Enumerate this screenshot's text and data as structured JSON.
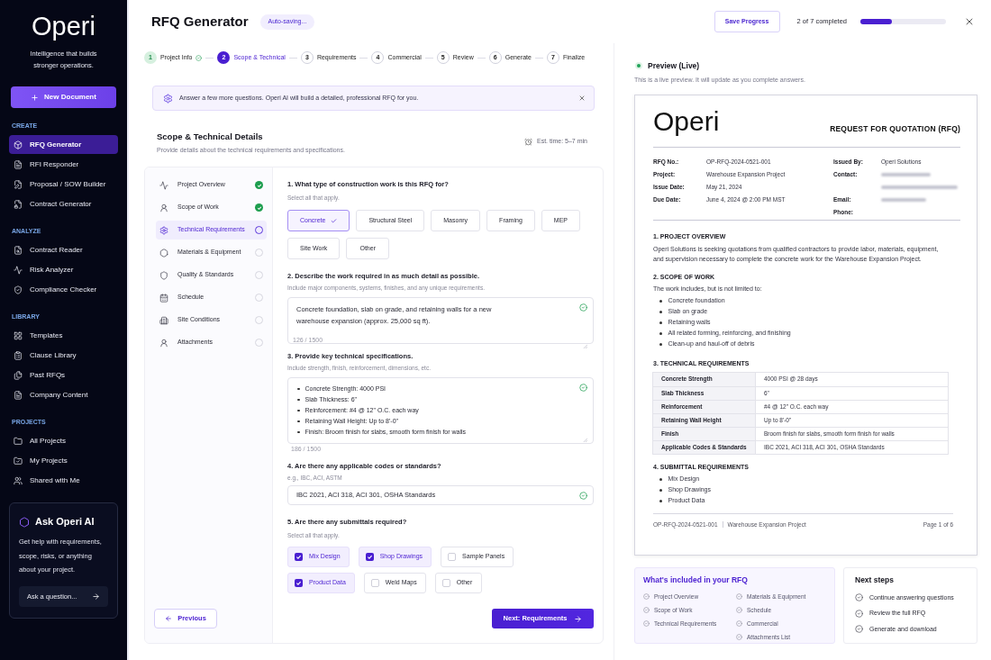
{
  "sidebar": {
    "logo": "Operi",
    "tagline": "Intelligence that builds stronger operations.",
    "new_button": "New Document",
    "sections": [
      {
        "title": "CREATE",
        "items": [
          {
            "label": "RFQ Generator",
            "selected": true
          },
          {
            "label": "RFI Responder",
            "selected": false
          },
          {
            "label": "Proposal / SOW Builder",
            "selected": false
          },
          {
            "label": "Contract Generator",
            "selected": false
          }
        ]
      },
      {
        "title": "ANALYZE",
        "items": [
          {
            "label": "Contract Reader",
            "selected": false
          },
          {
            "label": "Risk Analyzer",
            "selected": false
          },
          {
            "label": "Compliance Checker",
            "selected": false
          }
        ]
      },
      {
        "title": "LIBRARY",
        "items": [
          {
            "label": "Templates",
            "selected": false
          },
          {
            "label": "Clause Library",
            "selected": false
          },
          {
            "label": "Past RFQs",
            "selected": false
          },
          {
            "label": "Company Content",
            "selected": false
          }
        ]
      },
      {
        "title": "PROJECTS",
        "items": [
          {
            "label": "All Projects",
            "selected": false
          },
          {
            "label": "My Projects",
            "selected": false
          },
          {
            "label": "Shared with Me",
            "selected": false
          }
        ]
      }
    ],
    "assistant": {
      "title": "Ask Operi AI",
      "text": "Get help with requirements, scope, risks, or anything about your project.",
      "placeholder": "Ask a question..."
    }
  },
  "header": {
    "title": "RFQ Generator",
    "status": "Auto-saving...",
    "save_button": "Save Progress",
    "progress_text": "2 of 7 completed",
    "progress": {
      "level": 0.37
    }
  },
  "stepper": [
    {
      "number": "1",
      "label": "Project Info",
      "completed": true,
      "selected": false
    },
    {
      "number": "2",
      "label": "Scope & Technical",
      "completed": false,
      "selected": true
    },
    {
      "number": "3",
      "label": "Requirements",
      "completed": false,
      "selected": false
    },
    {
      "number": "4",
      "label": "Commercial",
      "completed": false,
      "selected": false
    },
    {
      "number": "5",
      "label": "Review",
      "completed": false,
      "selected": false
    },
    {
      "number": "6",
      "label": "Generate",
      "completed": false,
      "selected": false
    },
    {
      "number": "7",
      "label": "Finalize",
      "completed": false,
      "selected": false
    }
  ],
  "banner": {
    "text": "Answer a few more questions. Operi AI will build a detailed, professional RFQ for you."
  },
  "section": {
    "title": "Scope & Technical Details",
    "subtitle": "Provide details about the technical requirements and specifications.",
    "est_time": "Est. time: 5–7 min"
  },
  "form_nav": [
    {
      "label": "Project Overview",
      "completed": true,
      "selected": false
    },
    {
      "label": "Scope of Work",
      "completed": true,
      "selected": false
    },
    {
      "label": "Technical Requirements",
      "completed": false,
      "selected": true
    },
    {
      "label": "Materials & Equipment",
      "completed": false,
      "selected": false
    },
    {
      "label": "Quality & Standards",
      "completed": false,
      "selected": false
    },
    {
      "label": "Schedule",
      "completed": false,
      "selected": false
    },
    {
      "label": "Site Conditions",
      "completed": false,
      "selected": false
    },
    {
      "label": "Attachments",
      "completed": false,
      "selected": false
    }
  ],
  "questions": [
    {
      "kind": "chips",
      "label": "1. What type of construction work is this RFQ for?",
      "hint": "Select all that apply.",
      "options": [
        {
          "label": "Concrete",
          "selected": true
        },
        {
          "label": "Structural Steel",
          "selected": false
        },
        {
          "label": "Masonry",
          "selected": false
        },
        {
          "label": "Framing",
          "selected": false
        },
        {
          "label": "MEP",
          "selected": false
        },
        {
          "label": "Site Work",
          "selected": false
        },
        {
          "label": "Other",
          "selected": false
        }
      ]
    },
    {
      "kind": "textarea",
      "label": "2. Describe the work required in as much detail as possible.",
      "hint": "Include major components, systems, finishes, and any unique requirements.",
      "value": "Concrete foundation, slab on grade, and retaining walls for a new warehouse expansion (approx. 25,000 sq ft).",
      "counter": "126 / 1500",
      "valid": true
    },
    {
      "kind": "textarea",
      "label": "3. Provide key technical specifications.",
      "hint": "Include strength, finish, reinforcement, dimensions, etc.",
      "lines": [
        "Concrete Strength: 4000 PSI",
        "Slab Thickness: 6\"",
        "Reinforcement: #4 @ 12\" O.C. each way",
        "Retaining Wall Height: Up to 8'-0\"",
        "Finish: Broom finish for slabs, smooth form finish for walls"
      ],
      "counter": "186 / 1500",
      "valid": true
    },
    {
      "kind": "input",
      "label": "4. Are there any applicable codes or standards?",
      "hint": "e.g., IBC, ACI, ASTM",
      "value": "IBC 2021, ACI 318, ACI 301, OSHA Standards",
      "valid": true
    },
    {
      "kind": "checkboxes",
      "label": "5. Are there any submittals required?",
      "hint": "Select all that apply.",
      "options": [
        {
          "label": "Mix Design",
          "checked": true
        },
        {
          "label": "Shop Drawings",
          "checked": true
        },
        {
          "label": "Sample Panels",
          "checked": false
        },
        {
          "label": "Product Data",
          "checked": true
        },
        {
          "label": "Weld Maps",
          "checked": false
        },
        {
          "label": "Other",
          "checked": false
        }
      ]
    }
  ],
  "navigation": {
    "previous": "Previous",
    "next": "Next: Requirements"
  },
  "preview": {
    "title": "Preview (Live)",
    "subtitle": "This is a live preview. It will update as you complete answers.",
    "document": {
      "logo": "Operi",
      "heading": "REQUEST FOR QUOTATION (RFQ)",
      "meta_left": [
        {
          "label": "RFQ No.:",
          "value": "OP-RFQ-2024-0521-001"
        },
        {
          "label": "Project:",
          "value": "Warehouse Expansion Project"
        },
        {
          "label": "Issue Date:",
          "value": "May 21, 2024"
        },
        {
          "label": "Due Date:",
          "value": "June 4, 2024 @ 2:00 PM MST"
        }
      ],
      "meta_right": [
        {
          "label": "Issued By:",
          "value": "Operi Solutions",
          "blurred": false
        },
        {
          "label": "Contact:",
          "blurred": true
        },
        {
          "blurred": true
        },
        {
          "label": "Email:",
          "blurred": true
        },
        {
          "label": "Phone:",
          "blurred": false
        }
      ],
      "sections": [
        {
          "kind": "paragraph",
          "title": "1. PROJECT OVERVIEW",
          "text": "Operi Solutions is seeking quotations from qualified contractors to provide labor, materials, equipment, and supervision necessary to complete the concrete work for the Warehouse Expansion Project."
        },
        {
          "kind": "list",
          "title": "2. SCOPE OF WORK",
          "intro": "The work includes, but is not limited to:",
          "items": [
            "Concrete foundation",
            "Slab on grade",
            "Retaining walls",
            "All related forming, reinforcing, and finishing",
            "Clean-up and haul-off of debris"
          ]
        },
        {
          "kind": "table",
          "title": "3. TECHNICAL REQUIREMENTS",
          "rows": [
            [
              "Concrete Strength",
              "4000 PSI @ 28 days"
            ],
            [
              "Slab Thickness",
              "6\""
            ],
            [
              "Reinforcement",
              "#4 @ 12\" O.C. each way"
            ],
            [
              "Retaining Wall Height",
              "Up to 8'-0\""
            ],
            [
              "Finish",
              "Broom finish for slabs, smooth form finish for walls"
            ],
            [
              "Applicable Codes & Standards",
              "IBC 2021, ACI 318, ACI 301, OSHA Standards"
            ]
          ]
        },
        {
          "kind": "list",
          "title": "4. SUBMITTAL REQUIREMENTS",
          "items": [
            "Mix Design",
            "Shop Drawings",
            "Product Data"
          ]
        }
      ],
      "footer": {
        "rfq_number": "OP-RFQ-2024-0521-001",
        "project": "Warehouse Expansion Project",
        "page": "Page 1 of 6"
      }
    }
  },
  "included": {
    "title": "What's included in your RFQ",
    "columns": [
      [
        "Project Overview",
        "Scope of Work",
        "Technical Requirements"
      ],
      [
        "Materials & Equipment",
        "Schedule",
        "Commercial",
        "Attachments List"
      ]
    ]
  },
  "next_steps": {
    "title": "Next steps",
    "items": [
      "Continue answering questions",
      "Review the full RFQ",
      "Generate and download"
    ]
  }
}
